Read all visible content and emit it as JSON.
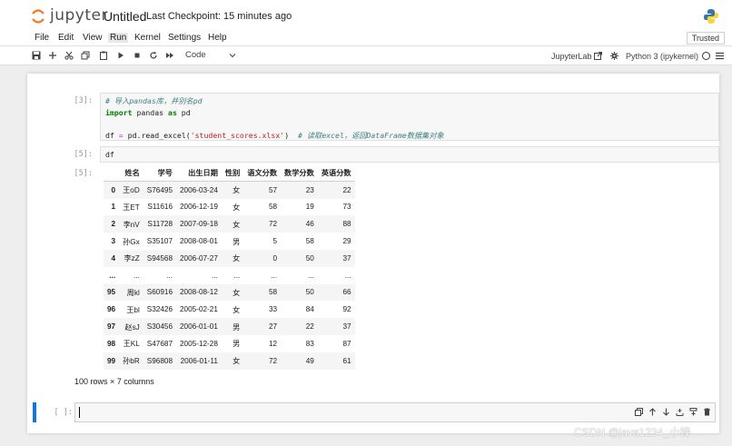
{
  "header": {
    "logo_text": "jupyter",
    "notebook_title": "Untitled",
    "checkpoint": "Last Checkpoint: 15 minutes ago"
  },
  "menubar": {
    "items": [
      "File",
      "Edit",
      "View",
      "Run",
      "Kernel",
      "Settings",
      "Help"
    ],
    "active": "Run",
    "trusted": "Trusted"
  },
  "toolbar": {
    "cell_type": "Code",
    "jupyterlab": "JupyterLab",
    "kernel": "Python 3 (ipykernel)"
  },
  "cells": [
    {
      "prompt": "[3]:",
      "lines": [
        "# 导入pandas库，并别名pd",
        "import pandas as pd",
        "",
        "df = pd.read_excel('student_scores.xlsx')  # 读取excel，返回DataFrame数据集对象"
      ]
    },
    {
      "prompt": "[5]:",
      "lines": [
        "df"
      ]
    }
  ],
  "output": {
    "prompt": "[5]:",
    "columns": [
      "",
      "姓名",
      "学号",
      "出生日期",
      "性别",
      "语文分数",
      "数学分数",
      "英语分数"
    ],
    "rows": [
      [
        "0",
        "王oD",
        "S76495",
        "2006-03-24",
        "女",
        "57",
        "23",
        "22"
      ],
      [
        "1",
        "王ET",
        "S11616",
        "2006-12-19",
        "女",
        "58",
        "19",
        "73"
      ],
      [
        "2",
        "李nV",
        "S11728",
        "2007-09-18",
        "女",
        "72",
        "46",
        "88"
      ],
      [
        "3",
        "孙Gx",
        "S35107",
        "2008-08-01",
        "男",
        "5",
        "58",
        "29"
      ],
      [
        "4",
        "李zZ",
        "S94568",
        "2006-07-27",
        "女",
        "0",
        "50",
        "37"
      ],
      [
        "...",
        "...",
        "...",
        "...",
        "...",
        "...",
        "...",
        "..."
      ],
      [
        "95",
        "周kl",
        "S60916",
        "2008-08-12",
        "女",
        "58",
        "50",
        "66"
      ],
      [
        "96",
        "王bl",
        "S32426",
        "2005-02-21",
        "女",
        "33",
        "84",
        "92"
      ],
      [
        "97",
        "赵sJ",
        "S30456",
        "2006-01-01",
        "男",
        "27",
        "22",
        "37"
      ],
      [
        "98",
        "王KL",
        "S47687",
        "2005-12-28",
        "男",
        "12",
        "83",
        "87"
      ],
      [
        "99",
        "孙bR",
        "S96808",
        "2006-01-11",
        "女",
        "72",
        "49",
        "61"
      ]
    ],
    "shape": "100 rows × 7 columns"
  },
  "active_cell": {
    "prompt": "[ ]:"
  },
  "watermark": "CSDN @java1234_小锋",
  "colors": {
    "accent": "#1976d2",
    "logo_orange": "#f37726",
    "python_blue": "#3776ab",
    "python_yellow": "#ffd43b"
  }
}
